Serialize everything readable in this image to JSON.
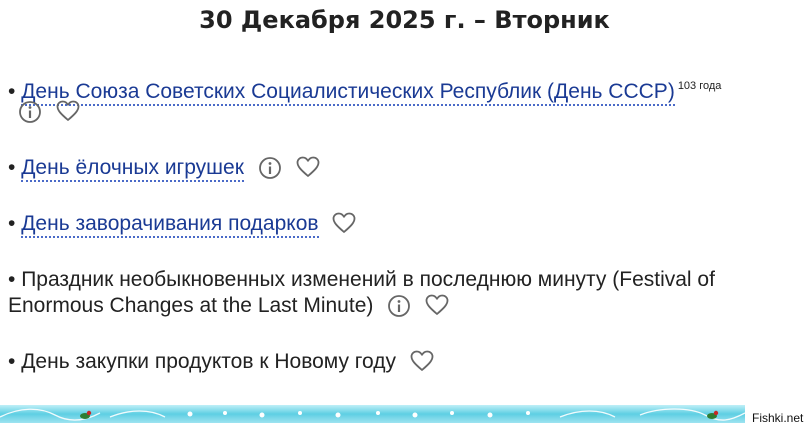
{
  "title": "30 Декабря 2025 г. – Вторник",
  "holidays": [
    {
      "bullet": "•",
      "text": "День Союза Советских Социалистических Республик (День СССР)",
      "years": "103 года"
    },
    {
      "bullet": "•",
      "text": "День ёлочных игрушек"
    },
    {
      "bullet": "•",
      "text": "День заворачивания подарков"
    },
    {
      "bullet": "•",
      "text": "Праздник необыкновенных изменений в последнюю минуту (Festival of Enormous Changes at the Last Minute)"
    },
    {
      "bullet": "•",
      "text": "День закупки продуктов к Новому году"
    }
  ],
  "icons": {
    "info": "info-icon",
    "favorite": "heart-icon"
  },
  "colors": {
    "link": "#1a3a94",
    "text": "#222222",
    "band": "#5ecfe3"
  },
  "watermark": "Fishki.net"
}
